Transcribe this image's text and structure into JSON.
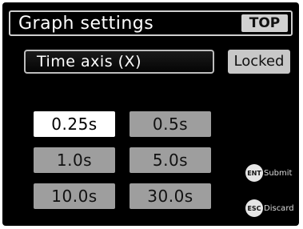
{
  "title_bar": {
    "title": "Graph settings",
    "top_button_label": "TOP"
  },
  "field": {
    "label": "Time axis (X)",
    "locked_label": "Locked"
  },
  "options": [
    {
      "label": "0.25s",
      "selected": true
    },
    {
      "label": "0.5s",
      "selected": false
    },
    {
      "label": "1.0s",
      "selected": false
    },
    {
      "label": "5.0s",
      "selected": false
    },
    {
      "label": "10.0s",
      "selected": false
    },
    {
      "label": "30.0s",
      "selected": false
    }
  ],
  "hints": {
    "submit": {
      "key": "ENT",
      "label": "Submit"
    },
    "discard": {
      "key": "ESC",
      "label": "Discard"
    }
  },
  "colors": {
    "background": "#000000",
    "option": "#9e9e9e",
    "option_selected": "#ffffff",
    "locked": "#c8c8c8"
  }
}
